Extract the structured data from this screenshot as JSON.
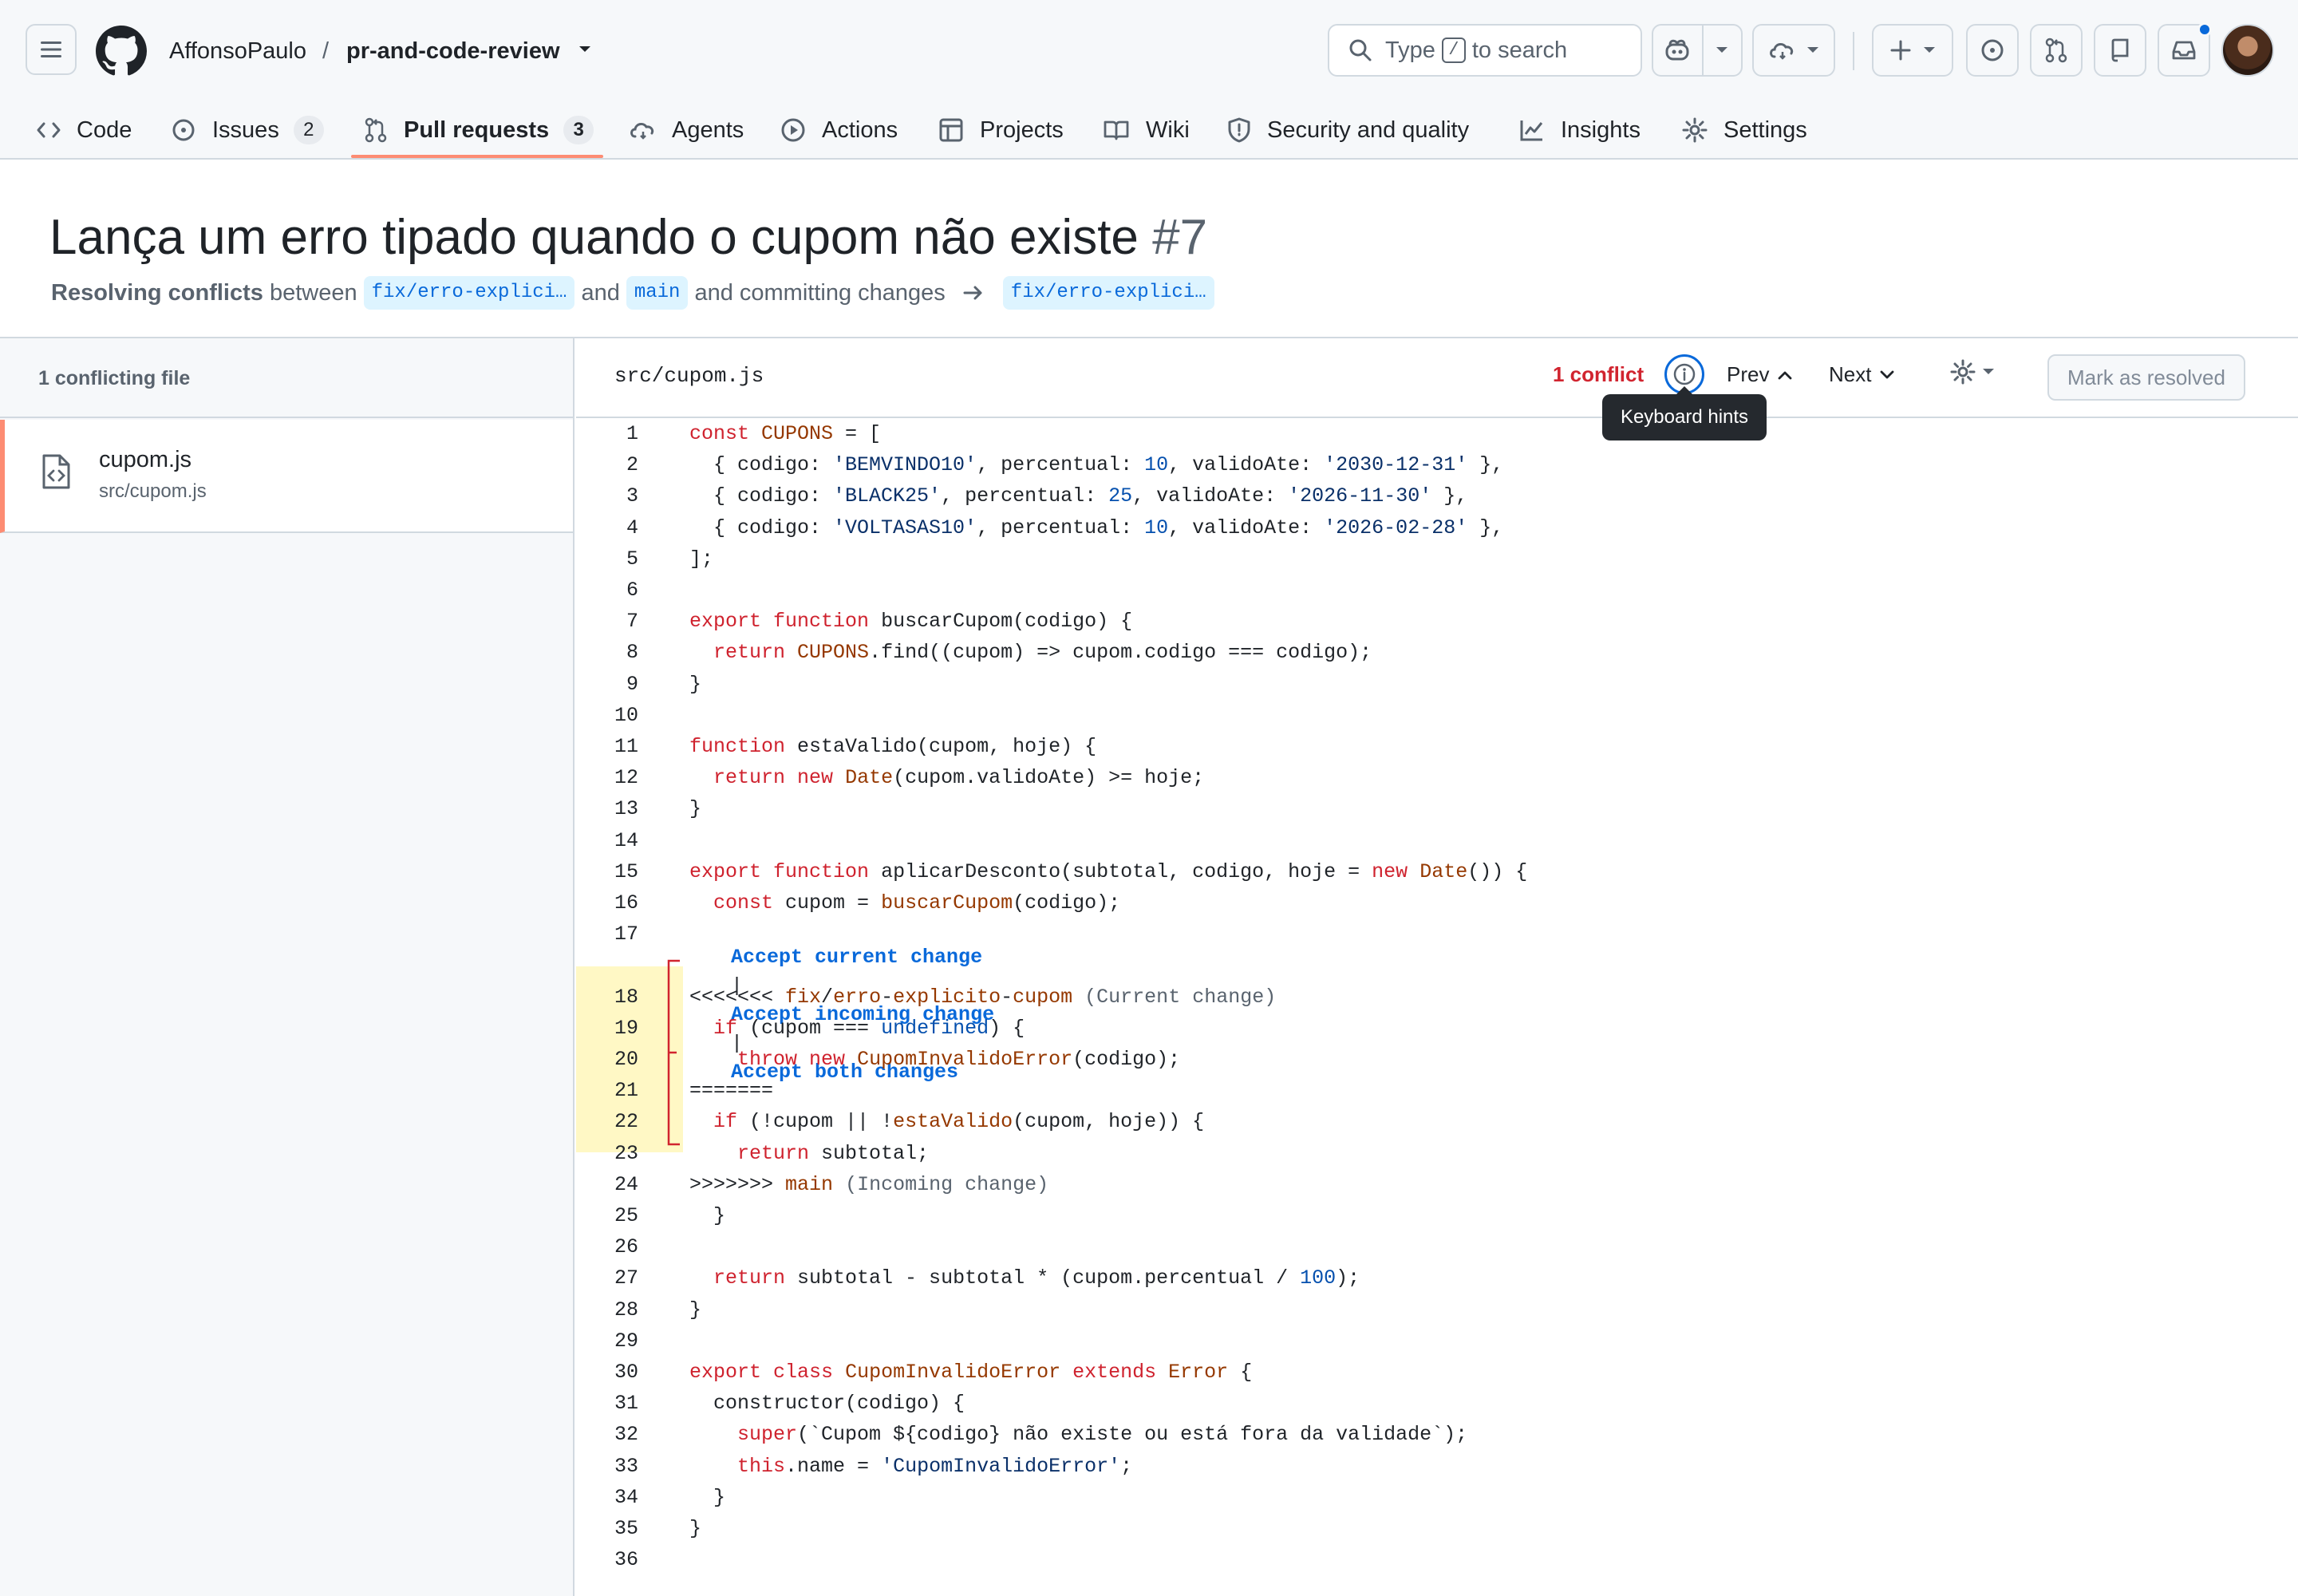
{
  "header": {
    "owner": "AffonsoPaulo",
    "separator": "/",
    "repo": "pr-and-code-review",
    "search": {
      "prefix": "Type",
      "key": "/",
      "suffix": "to search"
    }
  },
  "tabs": [
    {
      "label": "Code",
      "icon": "code-icon"
    },
    {
      "label": "Issues",
      "icon": "issue-icon",
      "count": "2"
    },
    {
      "label": "Pull requests",
      "icon": "pull-request-icon",
      "count": "3",
      "active": true
    },
    {
      "label": "Agents",
      "icon": "agents-icon"
    },
    {
      "label": "Actions",
      "icon": "play-icon"
    },
    {
      "label": "Projects",
      "icon": "table-icon"
    },
    {
      "label": "Wiki",
      "icon": "book-icon"
    },
    {
      "label": "Security and quality",
      "icon": "shield-icon"
    },
    {
      "label": "Insights",
      "icon": "graph-icon"
    },
    {
      "label": "Settings",
      "icon": "gear-icon"
    }
  ],
  "pr": {
    "title": "Lança um erro tipado quando o cupom não existe",
    "number": "#7",
    "sub": {
      "bold": "Resolving conflicts",
      "between": "between",
      "head_branch": "fix/erro-explici…",
      "and": "and",
      "base_branch": "main",
      "committing": "and committing changes",
      "target_branch": "fix/erro-explici…"
    }
  },
  "sidebar": {
    "heading": "1 conflicting file",
    "files": [
      {
        "name": "cupom.js",
        "path": "src/cupom.js"
      }
    ]
  },
  "editor": {
    "path": "src/cupom.js",
    "conflict_count": "1 conflict",
    "tooltip": "Keyboard hints",
    "prev": "Prev",
    "next": "Next",
    "mark_resolved": "Mark as resolved",
    "actions": {
      "accept_current": "Accept current change",
      "accept_incoming": "Accept incoming change",
      "accept_both": "Accept both changes",
      "divider": "|"
    },
    "lines": [
      "const CUPONS = [",
      "  { codigo: 'BEMVINDO10', percentual: 10, validoAte: '2030-12-31' },",
      "  { codigo: 'BLACK25', percentual: 25, validoAte: '2026-11-30' },",
      "  { codigo: 'VOLTASAS10', percentual: 10, validoAte: '2026-02-28' },",
      "];",
      "",
      "export function buscarCupom(codigo) {",
      "  return CUPONS.find((cupom) => cupom.codigo === codigo);",
      "}",
      "",
      "function estaValido(cupom, hoje) {",
      "  return new Date(cupom.validoAte) >= hoje;",
      "}",
      "",
      "export function aplicarDesconto(subtotal, codigo, hoje = new Date()) {",
      "  const cupom = buscarCupom(codigo);",
      "",
      "<<<<<<< fix/erro-explicito-cupom (Current change)",
      "  if (cupom === undefined) {",
      "    throw new CupomInvalidoError(codigo);",
      "=======",
      "  if (!cupom || !estaValido(cupom, hoje)) {",
      "    return subtotal;",
      ">>>>>>> main (Incoming change)",
      "  }",
      "",
      "  return subtotal - subtotal * (cupom.percentual / 100);",
      "}",
      "",
      "export class CupomInvalidoError extends Error {",
      "  constructor(codigo) {",
      "    super(`Cupom ${codigo} não existe ou está fora da validade`);",
      "    this.name = 'CupomInvalidoError';",
      "  }",
      "}",
      ""
    ]
  },
  "colors": {
    "accent": "#0969da",
    "conflict_red": "#d1242f",
    "tab_underline": "#fd8c73",
    "conflict_highlight": "#fff8c5"
  }
}
